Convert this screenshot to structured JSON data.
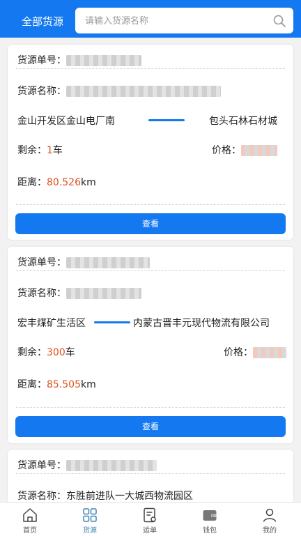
{
  "header": {
    "title": "全部货源",
    "search_placeholder": "请输入货源名称"
  },
  "cards": [
    {
      "order_label": "货源单号：",
      "name_label": "货源名称：",
      "origin": "金山开发区金山电厂南",
      "destination": "包头石林石材城",
      "remaining_label": "剩余：",
      "remaining_value": "1",
      "remaining_unit": "车",
      "price_label": "价格：",
      "distance_label": "距离：",
      "distance_value": "80.526",
      "distance_unit": "km",
      "button": "查看"
    },
    {
      "order_label": "货源单号：",
      "name_label": "货源名称：",
      "origin": "宏丰煤矿生活区",
      "destination": "内蒙古晋丰元现代物流有限公司",
      "remaining_label": "剩余：",
      "remaining_value": "300",
      "remaining_unit": "车",
      "price_label": "价格：",
      "distance_label": "距离：",
      "distance_value": "85.505",
      "distance_unit": "km",
      "button": "查看"
    },
    {
      "order_label": "货源单号：",
      "name_label": "货源名称：",
      "name_value": "东胜前进队一大城西物流园区"
    }
  ],
  "tabs": [
    {
      "label": "首页",
      "icon": "home-icon"
    },
    {
      "label": "货源",
      "icon": "grid-icon",
      "active": true
    },
    {
      "label": "运单",
      "icon": "document-icon"
    },
    {
      "label": "钱包",
      "icon": "wallet-icon"
    },
    {
      "label": "我的",
      "icon": "user-icon"
    }
  ],
  "colors": {
    "accent": "#1479f0",
    "value": "#e0521b",
    "active_tab": "#3f86b8"
  }
}
